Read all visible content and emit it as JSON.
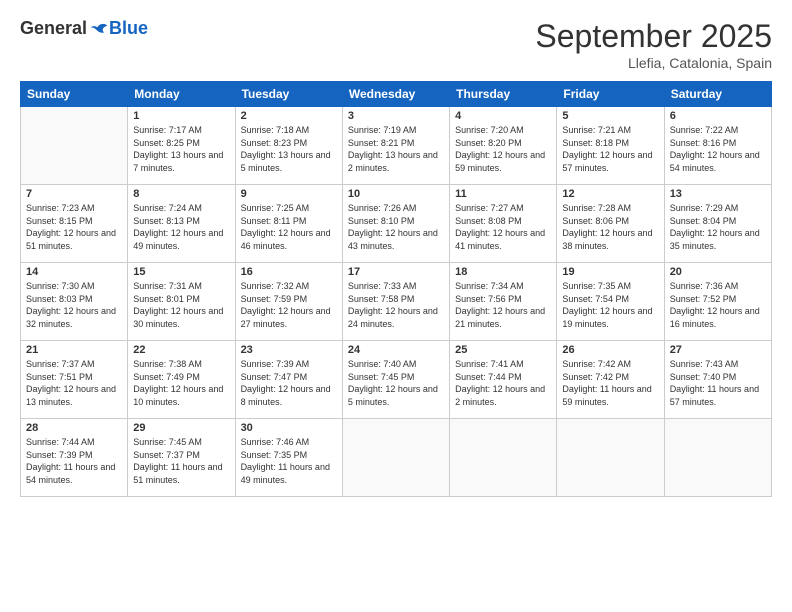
{
  "logo": {
    "general": "General",
    "blue": "Blue"
  },
  "title": "September 2025",
  "subtitle": "Llefia, Catalonia, Spain",
  "headers": [
    "Sunday",
    "Monday",
    "Tuesday",
    "Wednesday",
    "Thursday",
    "Friday",
    "Saturday"
  ],
  "weeks": [
    [
      {
        "day": "",
        "sunrise": "",
        "sunset": "",
        "daylight": ""
      },
      {
        "day": "1",
        "sunrise": "Sunrise: 7:17 AM",
        "sunset": "Sunset: 8:25 PM",
        "daylight": "Daylight: 13 hours and 7 minutes."
      },
      {
        "day": "2",
        "sunrise": "Sunrise: 7:18 AM",
        "sunset": "Sunset: 8:23 PM",
        "daylight": "Daylight: 13 hours and 5 minutes."
      },
      {
        "day": "3",
        "sunrise": "Sunrise: 7:19 AM",
        "sunset": "Sunset: 8:21 PM",
        "daylight": "Daylight: 13 hours and 2 minutes."
      },
      {
        "day": "4",
        "sunrise": "Sunrise: 7:20 AM",
        "sunset": "Sunset: 8:20 PM",
        "daylight": "Daylight: 12 hours and 59 minutes."
      },
      {
        "day": "5",
        "sunrise": "Sunrise: 7:21 AM",
        "sunset": "Sunset: 8:18 PM",
        "daylight": "Daylight: 12 hours and 57 minutes."
      },
      {
        "day": "6",
        "sunrise": "Sunrise: 7:22 AM",
        "sunset": "Sunset: 8:16 PM",
        "daylight": "Daylight: 12 hours and 54 minutes."
      }
    ],
    [
      {
        "day": "7",
        "sunrise": "Sunrise: 7:23 AM",
        "sunset": "Sunset: 8:15 PM",
        "daylight": "Daylight: 12 hours and 51 minutes."
      },
      {
        "day": "8",
        "sunrise": "Sunrise: 7:24 AM",
        "sunset": "Sunset: 8:13 PM",
        "daylight": "Daylight: 12 hours and 49 minutes."
      },
      {
        "day": "9",
        "sunrise": "Sunrise: 7:25 AM",
        "sunset": "Sunset: 8:11 PM",
        "daylight": "Daylight: 12 hours and 46 minutes."
      },
      {
        "day": "10",
        "sunrise": "Sunrise: 7:26 AM",
        "sunset": "Sunset: 8:10 PM",
        "daylight": "Daylight: 12 hours and 43 minutes."
      },
      {
        "day": "11",
        "sunrise": "Sunrise: 7:27 AM",
        "sunset": "Sunset: 8:08 PM",
        "daylight": "Daylight: 12 hours and 41 minutes."
      },
      {
        "day": "12",
        "sunrise": "Sunrise: 7:28 AM",
        "sunset": "Sunset: 8:06 PM",
        "daylight": "Daylight: 12 hours and 38 minutes."
      },
      {
        "day": "13",
        "sunrise": "Sunrise: 7:29 AM",
        "sunset": "Sunset: 8:04 PM",
        "daylight": "Daylight: 12 hours and 35 minutes."
      }
    ],
    [
      {
        "day": "14",
        "sunrise": "Sunrise: 7:30 AM",
        "sunset": "Sunset: 8:03 PM",
        "daylight": "Daylight: 12 hours and 32 minutes."
      },
      {
        "day": "15",
        "sunrise": "Sunrise: 7:31 AM",
        "sunset": "Sunset: 8:01 PM",
        "daylight": "Daylight: 12 hours and 30 minutes."
      },
      {
        "day": "16",
        "sunrise": "Sunrise: 7:32 AM",
        "sunset": "Sunset: 7:59 PM",
        "daylight": "Daylight: 12 hours and 27 minutes."
      },
      {
        "day": "17",
        "sunrise": "Sunrise: 7:33 AM",
        "sunset": "Sunset: 7:58 PM",
        "daylight": "Daylight: 12 hours and 24 minutes."
      },
      {
        "day": "18",
        "sunrise": "Sunrise: 7:34 AM",
        "sunset": "Sunset: 7:56 PM",
        "daylight": "Daylight: 12 hours and 21 minutes."
      },
      {
        "day": "19",
        "sunrise": "Sunrise: 7:35 AM",
        "sunset": "Sunset: 7:54 PM",
        "daylight": "Daylight: 12 hours and 19 minutes."
      },
      {
        "day": "20",
        "sunrise": "Sunrise: 7:36 AM",
        "sunset": "Sunset: 7:52 PM",
        "daylight": "Daylight: 12 hours and 16 minutes."
      }
    ],
    [
      {
        "day": "21",
        "sunrise": "Sunrise: 7:37 AM",
        "sunset": "Sunset: 7:51 PM",
        "daylight": "Daylight: 12 hours and 13 minutes."
      },
      {
        "day": "22",
        "sunrise": "Sunrise: 7:38 AM",
        "sunset": "Sunset: 7:49 PM",
        "daylight": "Daylight: 12 hours and 10 minutes."
      },
      {
        "day": "23",
        "sunrise": "Sunrise: 7:39 AM",
        "sunset": "Sunset: 7:47 PM",
        "daylight": "Daylight: 12 hours and 8 minutes."
      },
      {
        "day": "24",
        "sunrise": "Sunrise: 7:40 AM",
        "sunset": "Sunset: 7:45 PM",
        "daylight": "Daylight: 12 hours and 5 minutes."
      },
      {
        "day": "25",
        "sunrise": "Sunrise: 7:41 AM",
        "sunset": "Sunset: 7:44 PM",
        "daylight": "Daylight: 12 hours and 2 minutes."
      },
      {
        "day": "26",
        "sunrise": "Sunrise: 7:42 AM",
        "sunset": "Sunset: 7:42 PM",
        "daylight": "Daylight: 11 hours and 59 minutes."
      },
      {
        "day": "27",
        "sunrise": "Sunrise: 7:43 AM",
        "sunset": "Sunset: 7:40 PM",
        "daylight": "Daylight: 11 hours and 57 minutes."
      }
    ],
    [
      {
        "day": "28",
        "sunrise": "Sunrise: 7:44 AM",
        "sunset": "Sunset: 7:39 PM",
        "daylight": "Daylight: 11 hours and 54 minutes."
      },
      {
        "day": "29",
        "sunrise": "Sunrise: 7:45 AM",
        "sunset": "Sunset: 7:37 PM",
        "daylight": "Daylight: 11 hours and 51 minutes."
      },
      {
        "day": "30",
        "sunrise": "Sunrise: 7:46 AM",
        "sunset": "Sunset: 7:35 PM",
        "daylight": "Daylight: 11 hours and 49 minutes."
      },
      {
        "day": "",
        "sunrise": "",
        "sunset": "",
        "daylight": ""
      },
      {
        "day": "",
        "sunrise": "",
        "sunset": "",
        "daylight": ""
      },
      {
        "day": "",
        "sunrise": "",
        "sunset": "",
        "daylight": ""
      },
      {
        "day": "",
        "sunrise": "",
        "sunset": "",
        "daylight": ""
      }
    ]
  ]
}
